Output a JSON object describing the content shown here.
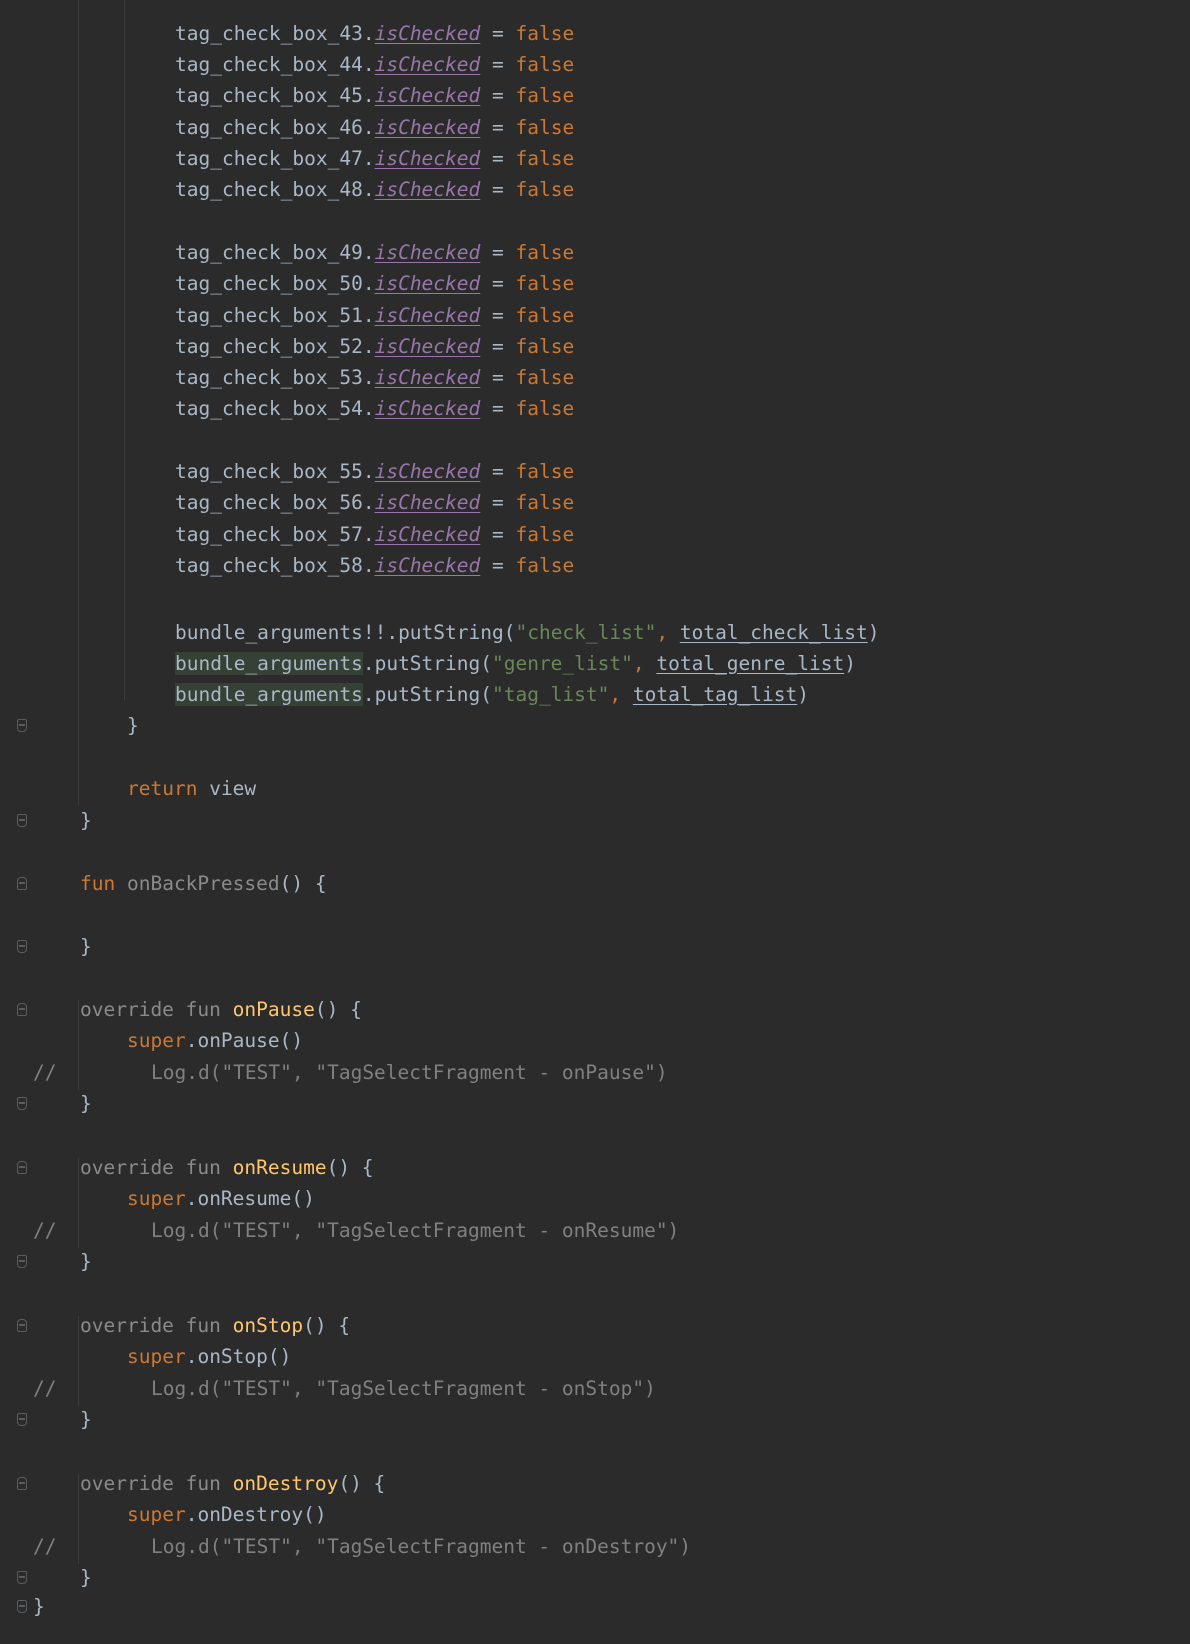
{
  "editor": {
    "checkbox_lines": [
      {
        "obj": "tag_check_box_43",
        "prop": "isChecked",
        "val": "false"
      },
      {
        "obj": "tag_check_box_44",
        "prop": "isChecked",
        "val": "false"
      },
      {
        "obj": "tag_check_box_45",
        "prop": "isChecked",
        "val": "false"
      },
      {
        "obj": "tag_check_box_46",
        "prop": "isChecked",
        "val": "false"
      },
      {
        "obj": "tag_check_box_47",
        "prop": "isChecked",
        "val": "false"
      },
      {
        "obj": "tag_check_box_48",
        "prop": "isChecked",
        "val": "false"
      },
      {
        "obj": "tag_check_box_49",
        "prop": "isChecked",
        "val": "false"
      },
      {
        "obj": "tag_check_box_50",
        "prop": "isChecked",
        "val": "false"
      },
      {
        "obj": "tag_check_box_51",
        "prop": "isChecked",
        "val": "false"
      },
      {
        "obj": "tag_check_box_52",
        "prop": "isChecked",
        "val": "false"
      },
      {
        "obj": "tag_check_box_53",
        "prop": "isChecked",
        "val": "false"
      },
      {
        "obj": "tag_check_box_54",
        "prop": "isChecked",
        "val": "false"
      },
      {
        "obj": "tag_check_box_55",
        "prop": "isChecked",
        "val": "false"
      },
      {
        "obj": "tag_check_box_56",
        "prop": "isChecked",
        "val": "false"
      },
      {
        "obj": "tag_check_box_57",
        "prop": "isChecked",
        "val": "false"
      },
      {
        "obj": "tag_check_box_58",
        "prop": "isChecked",
        "val": "false"
      }
    ],
    "bundle_lines": [
      {
        "obj": "bundle_arguments",
        "op": "!!.putString(",
        "key": "\"check_list\"",
        "arg": "total_check_list"
      },
      {
        "obj": "bundle_arguments",
        "op": ".putString(",
        "key": "\"genre_list\"",
        "arg": "total_genre_list"
      },
      {
        "obj": "bundle_arguments",
        "op": ".putString(",
        "key": "\"tag_list\"",
        "arg": "total_tag_list"
      }
    ],
    "return_kw": "return",
    "return_val": "view",
    "fun_kw": "fun",
    "override_kw": "override",
    "super_kw": "super",
    "on_back_pressed": "onBackPressed",
    "lifecycle": [
      {
        "name": "onPause",
        "log": "Log.d(\"TEST\", \"TagSelectFragment - onPause\")"
      },
      {
        "name": "onResume",
        "log": "Log.d(\"TEST\", \"TagSelectFragment - onResume\")"
      },
      {
        "name": "onStop",
        "log": "Log.d(\"TEST\", \"TagSelectFragment - onStop\")"
      },
      {
        "name": "onDestroy",
        "log": "Log.d(\"TEST\", \"TagSelectFragment - onDestroy\")"
      }
    ],
    "comment_marker": "//"
  }
}
